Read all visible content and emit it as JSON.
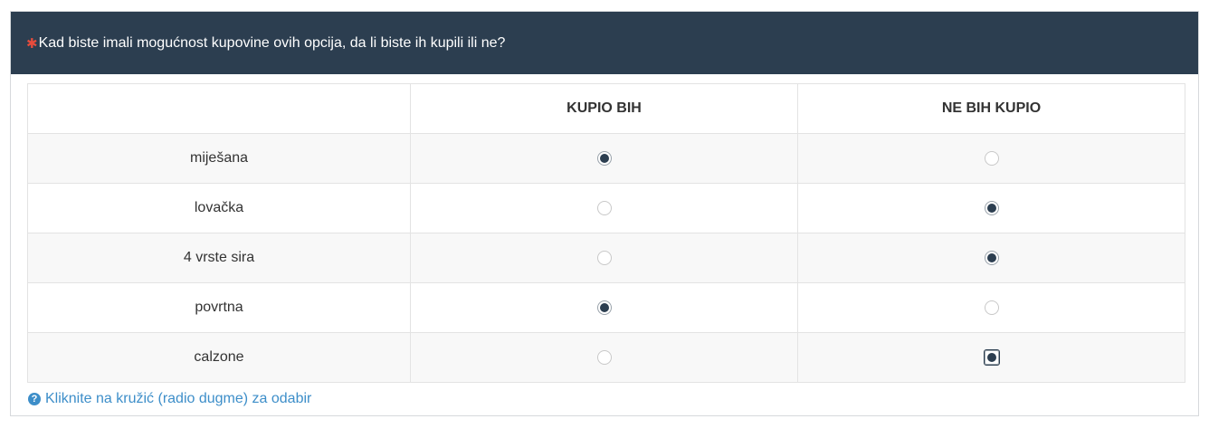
{
  "question": {
    "required_marker": "✱",
    "text": "Kad biste imali mogućnost kupovine ovih opcija, da li biste ih kupili ili ne?"
  },
  "columns": [
    "",
    "KUPIO BIH",
    "NE BIH KUPIO"
  ],
  "rows": [
    {
      "label": "miješana",
      "selected": 0
    },
    {
      "label": "lovačka",
      "selected": 1
    },
    {
      "label": "4 vrste sira",
      "selected": 1
    },
    {
      "label": "povrtna",
      "selected": 0
    },
    {
      "label": "calzone",
      "selected": 1
    }
  ],
  "focused_row": 4,
  "hint": {
    "icon": "question-circle-icon",
    "text": "Kliknite na kružić (radio dugme) za odabir"
  },
  "colors": {
    "header_bg": "#2c3e50",
    "accent_red": "#e74c3c",
    "link_blue": "#3d8ec9"
  }
}
